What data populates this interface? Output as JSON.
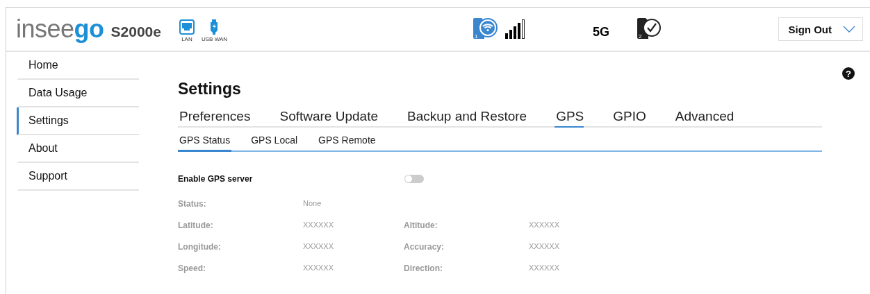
{
  "header": {
    "logo": {
      "dim": "insee",
      "accent": "go"
    },
    "model": "S2000e",
    "ports": [
      {
        "kind": "lan",
        "label": "LAN"
      },
      {
        "kind": "usb",
        "label": "USB WAN"
      }
    ],
    "sim1": "1",
    "network": "5G",
    "sim2": "2",
    "sign_out": "Sign Out"
  },
  "sidebar": {
    "items": [
      {
        "label": "Home",
        "selected": false
      },
      {
        "label": "Data Usage",
        "selected": false
      },
      {
        "label": "Settings",
        "selected": true
      },
      {
        "label": "About",
        "selected": false
      },
      {
        "label": "Support",
        "selected": false
      }
    ]
  },
  "page": {
    "title": "Settings",
    "help": "?",
    "tabs": [
      {
        "label": "Preferences",
        "selected": false
      },
      {
        "label": "Software Update",
        "selected": false
      },
      {
        "label": "Backup and Restore",
        "selected": false
      },
      {
        "label": "GPS",
        "selected": true
      },
      {
        "label": "GPIO",
        "selected": false
      },
      {
        "label": "Advanced",
        "selected": false
      }
    ],
    "subtabs": [
      {
        "label": "GPS Status",
        "selected": true
      },
      {
        "label": "GPS Local",
        "selected": false
      },
      {
        "label": "GPS Remote",
        "selected": false
      }
    ],
    "gps_server": {
      "label": "Enable GPS server",
      "on": false
    },
    "rows": [
      [
        {
          "label": "Status:",
          "value": "None"
        }
      ],
      [
        {
          "label": "Latitude:",
          "value": "XXXXXX"
        },
        {
          "label": "Altitude:",
          "value": "XXXXXX"
        }
      ],
      [
        {
          "label": "Longitude:",
          "value": "XXXXXX"
        },
        {
          "label": "Accuracy:",
          "value": "XXXXXX"
        }
      ],
      [
        {
          "label": "Speed:",
          "value": "XXXXXX"
        },
        {
          "label": "Direction:",
          "value": "XXXXXX"
        }
      ]
    ]
  }
}
